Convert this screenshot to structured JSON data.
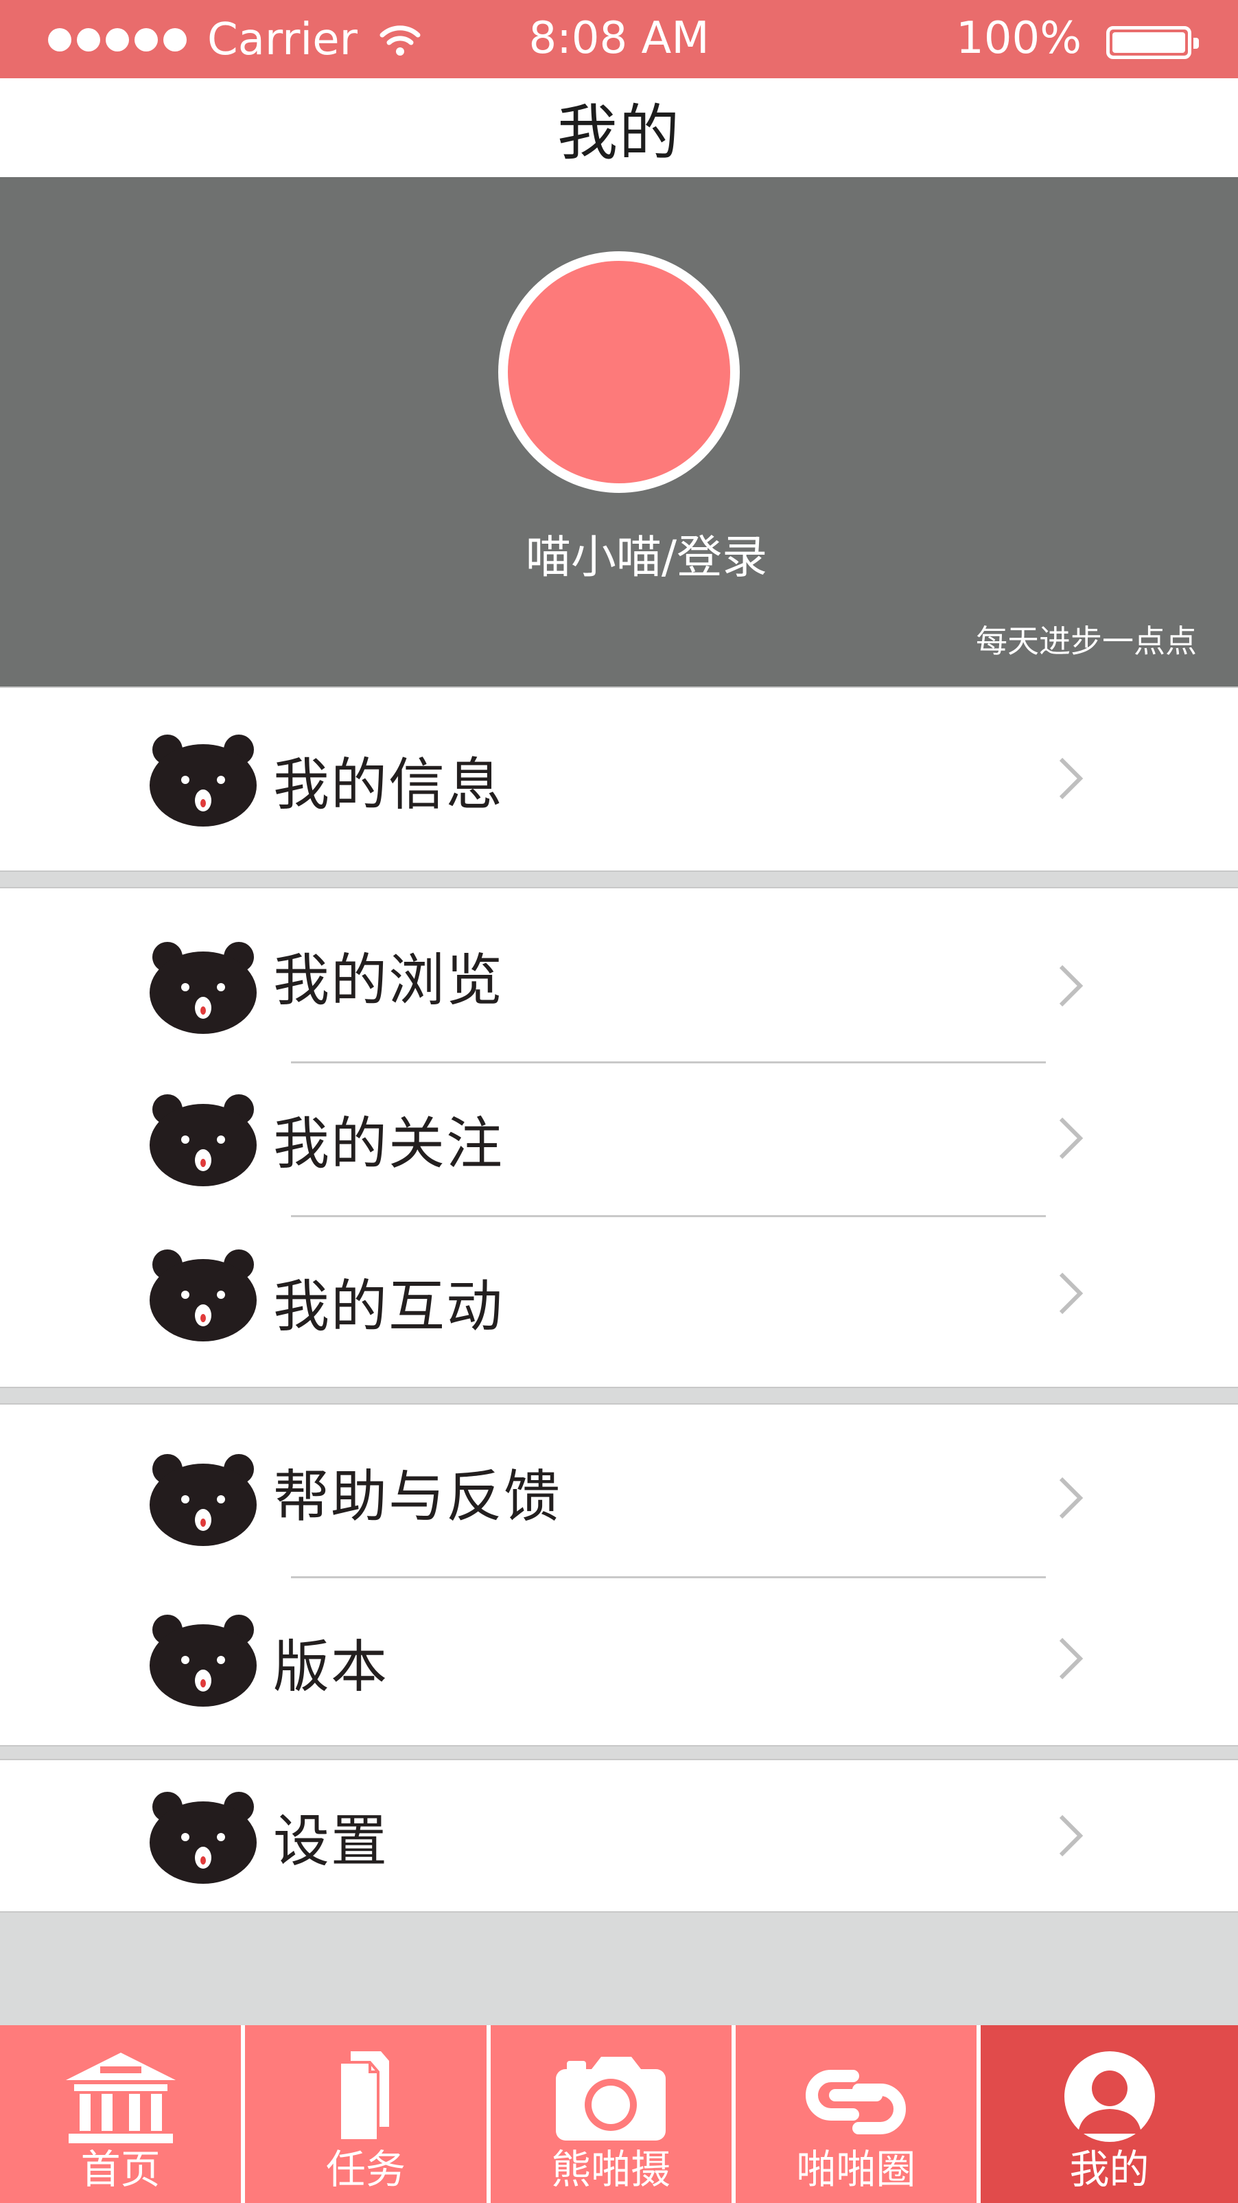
{
  "status_bar": {
    "carrier": "Carrier",
    "time": "8:08 AM",
    "battery": "100%"
  },
  "nav": {
    "title": "我的"
  },
  "profile": {
    "username": "喵小喵/登录",
    "slogan": "每天进步一点点"
  },
  "menu": {
    "info": "我的信息",
    "browse": "我的浏览",
    "follow": "我的关注",
    "interact": "我的互动",
    "help": "帮助与反馈",
    "version": "版本",
    "settings": "设置"
  },
  "tabbar": {
    "home": "首页",
    "tasks": "任务",
    "camera": "熊啪摄",
    "circle": "啪啪圈",
    "mine": "我的"
  },
  "colors": {
    "status_bar": "#e96c6c",
    "profile_bg": "#6f7170",
    "avatar": "#fd7a7a",
    "tab": "#ff7b7b",
    "tab_active": "#e14b4b",
    "page_bg": "#d9dada"
  },
  "icons": {
    "menu_row": "bear-icon",
    "row_arrow": "chevron-right-icon",
    "tabs": [
      "bank-icon",
      "document-icon",
      "camera-icon",
      "link-icon",
      "user-icon"
    ]
  }
}
